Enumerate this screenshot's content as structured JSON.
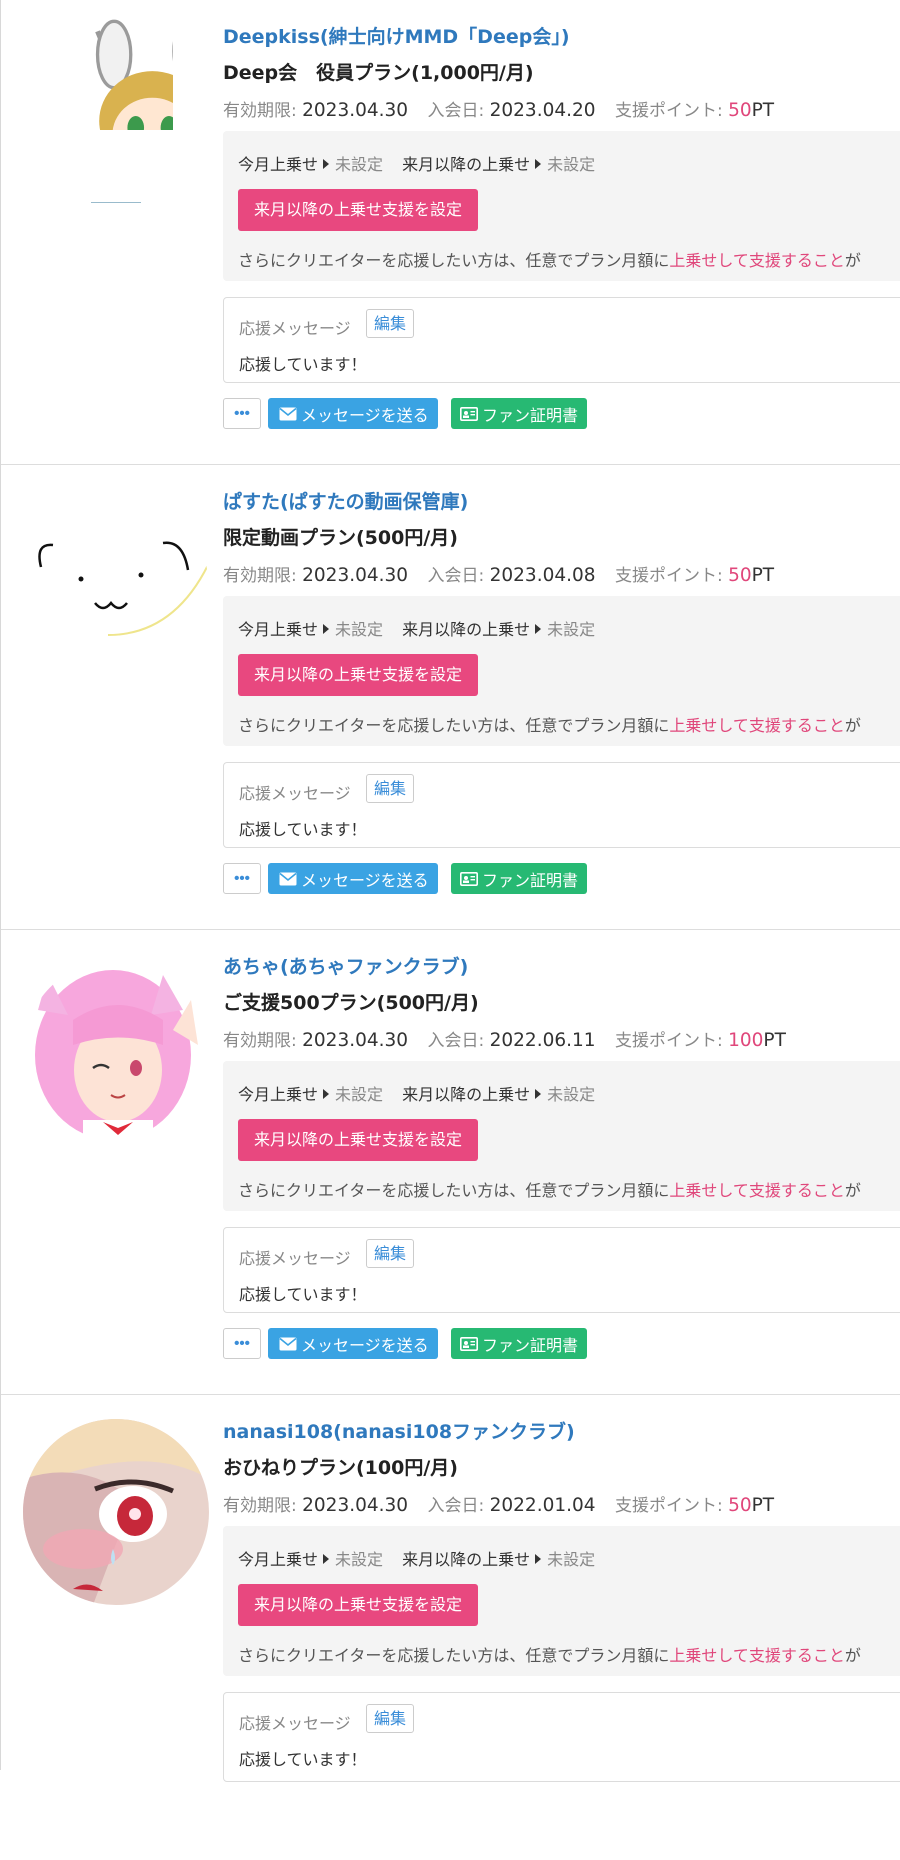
{
  "labels": {
    "expiry": "有効期限:",
    "join": "入会日:",
    "points": "支援ポイント:",
    "points_unit": "PT",
    "this_month_upsell": "今月上乗せ",
    "next_month_upsell": "来月以降の上乗せ",
    "unset": "未設定",
    "set_button": "来月以降の上乗せ支援を設定",
    "note_prefix": "さらにクリエイターを応援したい方は、任意でプラン月額に",
    "note_link": "上乗せして支援すること",
    "note_suffix": "が",
    "message_label": "応援メッセージ",
    "edit": "編集",
    "more": "•••",
    "send_message": "メッセージを送る",
    "fan_certificate": "ファン証明書"
  },
  "colors": {
    "creator_link": "#2f79bd",
    "accent_pink": "#e8487f",
    "message_blue": "#3aa3e3",
    "certificate_green": "#27b973"
  },
  "entries": [
    {
      "creator": "Deepkiss(紳士向けMMD「Deep会」)",
      "plan": "Deep会　役員プラン(1,000円/月)",
      "expiry": "2023.04.30",
      "join": "2023.04.20",
      "points": "50",
      "message": "応援しています！",
      "avatar": "bunny-eared-blonde-character-avatar"
    },
    {
      "creator": "ぱすた(ぱすたの動画保管庫)",
      "plan": "限定動画プラン(500円/月)",
      "expiry": "2023.04.30",
      "join": "2023.04.08",
      "points": "50",
      "message": "応援しています！",
      "avatar": "line-drawn-dog-face-avatar"
    },
    {
      "creator": "あちゃ(あちゃファンクラブ)",
      "plan": "ご支援500プラン(500円/月)",
      "expiry": "2023.04.30",
      "join": "2022.06.11",
      "points": "100",
      "message": "応援しています！",
      "avatar": "pink-haired-girl-avatar"
    },
    {
      "creator": "nanasi108(nanasi108ファンクラブ)",
      "plan": "おひねりプラン(100円/月)",
      "expiry": "2023.04.30",
      "join": "2022.01.04",
      "points": "50",
      "message": "応援しています！",
      "avatar": "blushing-girl-closeup-avatar"
    }
  ]
}
